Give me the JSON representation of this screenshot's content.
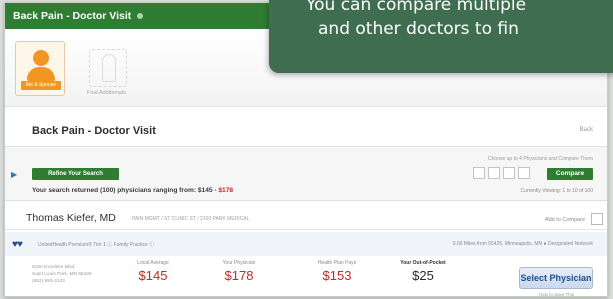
{
  "window": {
    "title": "Back Pain - Doctor Visit"
  },
  "profile": {
    "primary_tag": "Me & Spouse",
    "secondary_label": "Find Additionals"
  },
  "callout": {
    "line1": "You can compare multiple",
    "line2": "and other doctors to fin"
  },
  "page": {
    "section_title": "Back Pain - Doctor Visit",
    "back_link": "Back"
  },
  "search": {
    "refine_label": "Refine Your Search",
    "results_prefix": "Your search returned (100) physicians ranging from: $145 - ",
    "results_range": "$178",
    "compare_hint": "Choose up to 4 Physicians and Compare Them",
    "compare_label": "Compare",
    "viewing": "Currently Viewing: 1 to 10 of 100"
  },
  "doctor": {
    "name": "Thomas Kiefer, MD",
    "subtitle": "PAIN MGMT / ST CLINIC ST / 2100 PARK MEDICAL",
    "add_to_compare": "Add to Compare"
  },
  "meta": {
    "hearts": "♥♥",
    "left": "UnitedHealth Premium® Tier 1 ⓘ   Family Practice ⓘ",
    "right": "0.00 Miles from 55426, Minneapolis, MN  ●  Designated Network"
  },
  "costs": {
    "address_lines": [
      "8100 Excelsior Blvd",
      "Saint Louis Park, MN 55426",
      "(952) 993-3123"
    ],
    "columns": [
      {
        "label": "Local Average",
        "value": "$145"
      },
      {
        "label": "Your Physician",
        "value": "$178"
      },
      {
        "label": "Health Plan Pays",
        "value": "$153"
      },
      {
        "label": "Your Out-of-Pocket",
        "value": "$25"
      }
    ],
    "select_label": "Select Physician",
    "select_sub": "How to Save This"
  },
  "colors": {
    "brand_green": "#2e7d32",
    "callout_green": "#3f6d4f",
    "price_red": "#c62828",
    "link_blue": "#1e4f8c",
    "avatar_orange": "#f29622"
  },
  "icons": {
    "avatar": "user-icon",
    "hearts": "heart-icon",
    "arrow": "arrow-right-icon",
    "title_dot": "dot-icon"
  }
}
